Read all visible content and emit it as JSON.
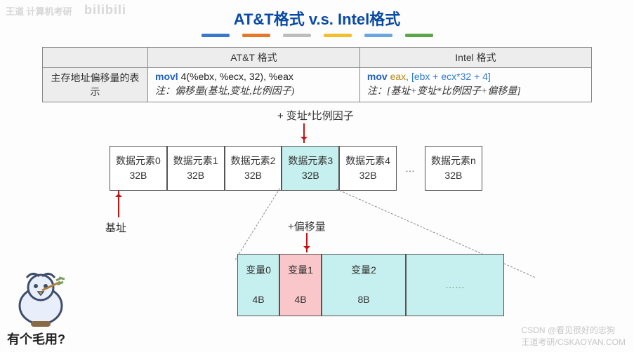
{
  "watermarks": {
    "top_left1": "王道 计算机考研",
    "top_left2": "bilibili",
    "bottom_right": "王道考研/CSKAOYAN.COM",
    "csdn": "CSDN @看见很好的忠狗"
  },
  "title": "AT&T格式 v.s. Intel格式",
  "table": {
    "header_att": "AT&T 格式",
    "header_intel": "Intel 格式",
    "row_label": "主存地址偏移量的表示",
    "att_code_kw": "movl",
    "att_code_rest": " 4(%ebx, %ecx, 32), %eax",
    "att_note": "注：偏移量(基址,变址,比例因子)",
    "intel_code_kw": "mov",
    "intel_code_reg": " eax",
    "intel_code_rest": ", [ebx + ecx*32 + 4]",
    "intel_note": "注：[基址+变址*比例因子+偏移量]"
  },
  "labels": {
    "top_arrow": "+ 变址*比例因子",
    "base": "基址",
    "offset": "+偏移量"
  },
  "row1": {
    "c0_line1": "数据元素0",
    "c0_line2": "32B",
    "c1_line1": "数据元素1",
    "c1_line2": "32B",
    "c2_line1": "数据元素2",
    "c2_line2": "32B",
    "c3_line1": "数据元素3",
    "c3_line2": "32B",
    "c4_line1": "数据元素4",
    "c4_line2": "32B",
    "cN_line1": "数据元素n",
    "cN_line2": "32B",
    "ellipsis": "…"
  },
  "row2": {
    "v0_line1": "变量0",
    "v0_line2": "4B",
    "v1_line1": "变量1",
    "v1_line2": "4B",
    "v2_line1": "变量2",
    "v2_line2": "8B",
    "dots": "……"
  },
  "caption": "有个毛用?"
}
